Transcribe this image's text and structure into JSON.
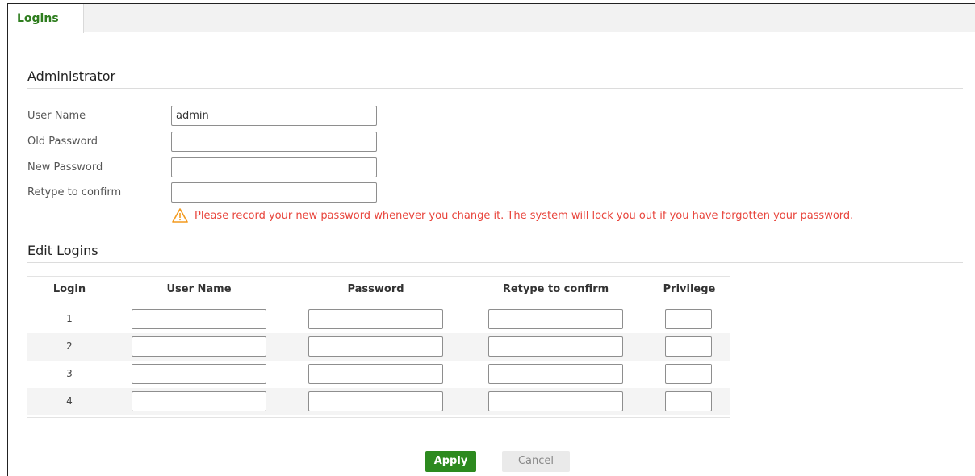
{
  "tabs": [
    {
      "label": "Logins"
    }
  ],
  "administrator": {
    "title": "Administrator",
    "fields": [
      {
        "label": "User Name",
        "value": "admin"
      },
      {
        "label": "Old Password",
        "value": ""
      },
      {
        "label": "New Password",
        "value": ""
      },
      {
        "label": "Retype to confirm",
        "value": ""
      }
    ],
    "warning": "Please record your new password whenever you change it. The system will lock you out if you have forgotten your password."
  },
  "edit_logins": {
    "title": "Edit Logins",
    "columns": [
      "Login",
      "User Name",
      "Password",
      "Retype to confirm",
      "Privilege"
    ],
    "rows": [
      {
        "login": "1",
        "user_name": "",
        "password": "",
        "retype": "",
        "privilege": ""
      },
      {
        "login": "2",
        "user_name": "",
        "password": "",
        "retype": "",
        "privilege": ""
      },
      {
        "login": "3",
        "user_name": "",
        "password": "",
        "retype": "",
        "privilege": ""
      },
      {
        "login": "4",
        "user_name": "",
        "password": "",
        "retype": "",
        "privilege": ""
      }
    ]
  },
  "buttons": {
    "apply": "Apply",
    "cancel": "Cancel"
  },
  "colors": {
    "accent": "#2d8a1f",
    "warning": "#e8453c",
    "tab_text": "#2e7d1e"
  }
}
